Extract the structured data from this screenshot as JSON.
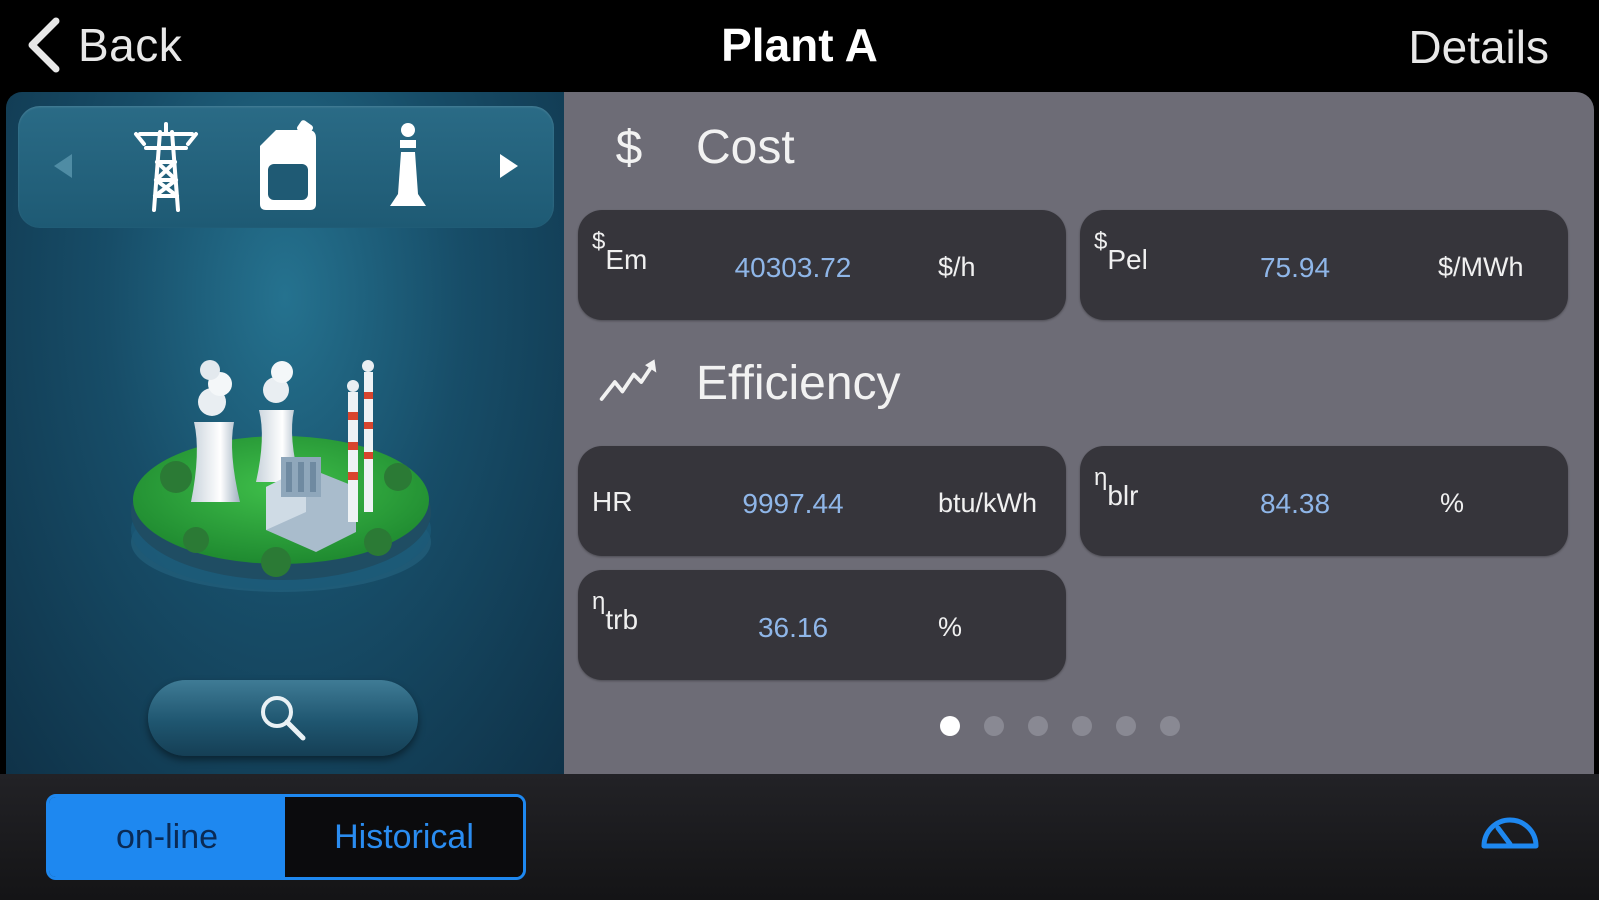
{
  "nav": {
    "back_label": "Back",
    "title": "Plant A",
    "details_label": "Details"
  },
  "left_panel": {
    "carousel_icons": [
      "transmission-tower-icon",
      "fuel-canister-icon",
      "chimney-info-icon"
    ],
    "illustration": "power-plant-illustration",
    "search_icon": "search-icon"
  },
  "cost": {
    "title": "Cost",
    "icon": "dollar-icon",
    "cards": [
      {
        "prefix": "$",
        "sub": "Em",
        "value": "40303.72",
        "unit": "$/h"
      },
      {
        "prefix": "$",
        "sub": "Pel",
        "value": "75.94",
        "unit": "$/MWh"
      }
    ]
  },
  "efficiency": {
    "title": "Efficiency",
    "icon": "trend-up-icon",
    "cards": [
      {
        "label": "HR",
        "value": "9997.44",
        "unit": "btu/kWh"
      },
      {
        "prefix": "η",
        "sub": "blr",
        "value": "84.38",
        "unit": "%"
      },
      {
        "prefix": "η",
        "sub": "trb",
        "value": "36.16",
        "unit": "%"
      }
    ]
  },
  "pager": {
    "count": 6,
    "active": 0
  },
  "bottom": {
    "online_label": "on-line",
    "historical_label": "Historical",
    "gauge_icon": "gauge-icon"
  },
  "colors": {
    "accent": "#1e88f0",
    "value_text": "#8fb6e8",
    "card_bg": "#36353b",
    "panel_bg": "#6d6c76"
  }
}
